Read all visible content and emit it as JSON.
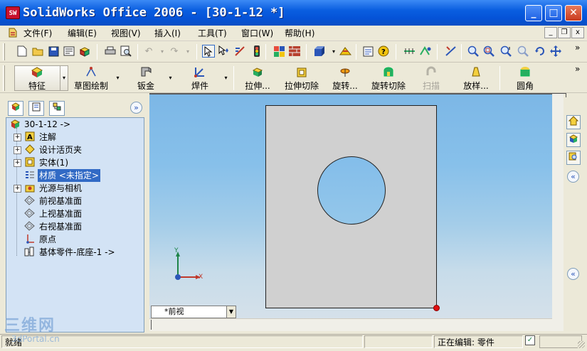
{
  "window": {
    "title": "SolidWorks Office 2006 - [30-1-12 *]",
    "app_icon_text": "SW",
    "controls": {
      "minimize": "_",
      "maximize": "□",
      "close": "✕"
    }
  },
  "menubar": {
    "items": [
      "文件(F)",
      "编辑(E)",
      "视图(V)",
      "插入(I)",
      "工具(T)",
      "窗口(W)",
      "帮助(H)"
    ],
    "mdi_controls": {
      "minimize": "_",
      "restore": "❐",
      "close": "x"
    }
  },
  "feature_toolbar": {
    "expander": "»",
    "groups": [
      {
        "label": "特征",
        "icon": "feature-icon"
      },
      {
        "label": "草图绘制",
        "icon": "sketch-icon"
      },
      {
        "label": "钣金",
        "icon": "sheetmetal-icon"
      },
      {
        "label": "焊件",
        "icon": "weldment-icon"
      }
    ],
    "tools": [
      {
        "label": "拉伸...",
        "icon": "extrude-icon",
        "enabled": true
      },
      {
        "label": "拉伸切除",
        "icon": "extrude-cut-icon",
        "enabled": true
      },
      {
        "label": "旋转...",
        "icon": "revolve-icon",
        "enabled": true
      },
      {
        "label": "旋转切除",
        "icon": "revolve-cut-icon",
        "enabled": true
      },
      {
        "label": "扫描",
        "icon": "sweep-icon",
        "enabled": false
      },
      {
        "label": "放样...",
        "icon": "loft-icon",
        "enabled": true
      },
      {
        "label": "圆角",
        "icon": "fillet-icon",
        "enabled": true
      }
    ]
  },
  "feature_tree": {
    "collapse_button": "»",
    "root": "30-1-12 ->",
    "nodes": [
      {
        "label": "注解",
        "expandable": true,
        "icon": "annotation-icon"
      },
      {
        "label": "设计活页夹",
        "expandable": true,
        "icon": "design-binder-icon"
      },
      {
        "label": "实体(1)",
        "expandable": true,
        "icon": "solid-body-icon"
      },
      {
        "label": "材质 <未指定>",
        "expandable": false,
        "icon": "material-icon",
        "selected": true
      },
      {
        "label": "光源与相机",
        "expandable": true,
        "icon": "lights-cameras-icon"
      },
      {
        "label": "前视基准面",
        "expandable": false,
        "icon": "plane-icon"
      },
      {
        "label": "上视基准面",
        "expandable": false,
        "icon": "plane-icon"
      },
      {
        "label": "右视基准面",
        "expandable": false,
        "icon": "plane-icon"
      },
      {
        "label": "原点",
        "expandable": false,
        "icon": "origin-icon"
      },
      {
        "label": "基体零件-底座-1 ->",
        "expandable": false,
        "icon": "base-part-icon"
      }
    ]
  },
  "viewport": {
    "view_name": "*前视",
    "triad": {
      "x": "X",
      "y": "Y"
    },
    "colors": {
      "sky_top": "#7cb7e6",
      "sky_bottom": "#d9e2ea",
      "part_face": "#d0d0d0",
      "point": "#e01010"
    }
  },
  "taskpane": {
    "collapse_top": "«",
    "collapse_bottom": "«"
  },
  "statusbar": {
    "left": "就绪",
    "mode": "正在编辑: 零件"
  },
  "watermark": {
    "line1": "三维网",
    "line2": "3dPortal.cn"
  }
}
